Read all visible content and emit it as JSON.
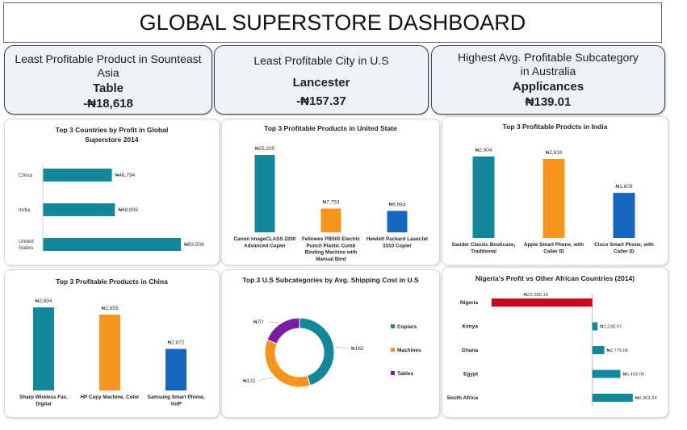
{
  "header": {
    "title": "GLOBAL SUPERSTORE DASHBOARD"
  },
  "kpis": [
    {
      "label": "Least Profitable Product in Sounteast Asia",
      "name": "Table",
      "value": "-₦18,618"
    },
    {
      "label": "Least Profitable City in U.S",
      "name": "Lancester",
      "value": "-₦157.37"
    },
    {
      "label": "Highest Avg. Profitable Subcategory in Australia",
      "name": "Applicances",
      "value": "₦139.01"
    }
  ],
  "colors": {
    "teal": "#13889a",
    "orange": "#f7941d",
    "blue": "#1565c0",
    "purple": "#7b1fa2",
    "red": "#d0021b"
  },
  "chart_data": [
    {
      "id": "countries",
      "type": "bar",
      "orientation": "horizontal",
      "title": "Top 3 Countries by Profit in Global Superstore 2014",
      "categories": [
        "China",
        "India",
        "United States"
      ],
      "values": [
        46794,
        48808,
        93508
      ],
      "labels": [
        "₦46,794",
        "₦48,808",
        "₦93,508"
      ],
      "colors": [
        "#13889a",
        "#13889a",
        "#13889a"
      ],
      "xlim": [
        0,
        100000
      ]
    },
    {
      "id": "us_products",
      "type": "bar",
      "title": "Top 3 Profitable Products in United State",
      "categories": [
        "Canon imageCLASS 2200 Advanced Copier",
        "Fellowes PB500 Electric Punch Plastic Comb Binding Machine with Manual Bind",
        "Hewlett Packard LaserJet 3310 Copier"
      ],
      "values": [
        25200,
        7753,
        6984
      ],
      "labels": [
        "₦25,200",
        "₦7,753",
        "₦6,984"
      ],
      "colors": [
        "#13889a",
        "#f7941d",
        "#1565c0"
      ],
      "ylim": [
        0,
        25200
      ]
    },
    {
      "id": "india_products",
      "type": "bar",
      "title": "Top 3 Profitable Prodcts in India",
      "categories": [
        "Sauder Classic Bookcase, Traditional",
        "Apple Smart Phone, with Caller ID",
        "Cisco Smart Phone, with Caller ID"
      ],
      "values": [
        2904,
        2818,
        1609
      ],
      "labels": [
        "₦2,904",
        "₦2,818",
        "₦1,609"
      ],
      "colors": [
        "#13889a",
        "#f7941d",
        "#1565c0"
      ],
      "ylim": [
        0,
        2904
      ]
    },
    {
      "id": "china_products",
      "type": "bar",
      "title": "Top 3 Profitable Products in China",
      "categories": [
        "Sharp Wireless Fax, Digital",
        "HP Copy Machine, Color",
        "Samsung Smart Phone, VoIP"
      ],
      "values": [
        2894,
        2855,
        2672
      ],
      "labels": [
        "₦2,894",
        "₦2,855",
        "₦2,672"
      ],
      "colors": [
        "#13889a",
        "#f7941d",
        "#1565c0"
      ],
      "ylim": [
        2450,
        2894
      ]
    },
    {
      "id": "shipping",
      "type": "pie",
      "donut": true,
      "title": "Top 3 U.S Subcategories by Avg. Shipping Cost in U.S",
      "categories": [
        "Copiers",
        "Machines",
        "Tables"
      ],
      "values": [
        165,
        132,
        70
      ],
      "labels": [
        "₦165",
        "₦132",
        "₦70"
      ],
      "colors": [
        "#13889a",
        "#f7941d",
        "#7b1fa2"
      ],
      "legend_position": "right"
    },
    {
      "id": "africa",
      "type": "bar",
      "orientation": "horizontal",
      "title": "Nigeria's Profit vs Other African Countries (2014)",
      "categories": [
        "Nigeria",
        "Kenya",
        "Ghana",
        "Egypt",
        "South Africa"
      ],
      "values": [
        -23285.19,
        1238.07,
        2775.06,
        6493.05,
        9363.24
      ],
      "labels": [
        "-₦23,285.19",
        "₦1,238.07",
        "₦2,775.06",
        "₦6,493.05",
        "₦9,363.24"
      ],
      "colors": [
        "#d0021b",
        "#13889a",
        "#13889a",
        "#13889a",
        "#13889a"
      ],
      "xlim": [
        -23285.19,
        15000
      ]
    }
  ]
}
